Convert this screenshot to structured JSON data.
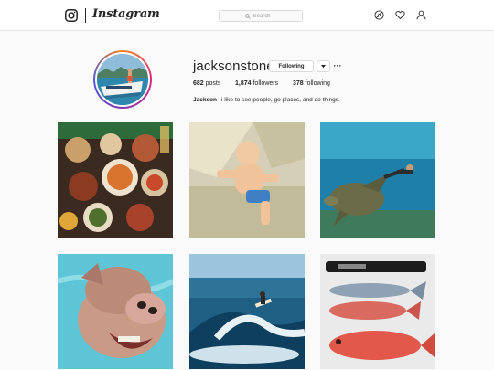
{
  "header": {
    "logo_text": "Instagram",
    "search": {
      "placeholder": "Search"
    },
    "icons": [
      "explore-compass-icon",
      "heart-activity-icon",
      "profile-person-icon"
    ]
  },
  "profile": {
    "username": "jacksonstone",
    "following_button_label": "Following",
    "more_label": "···",
    "stats": {
      "posts_count": "682",
      "posts_label": "posts",
      "followers_count": "1,874",
      "followers_label": "followers",
      "following_count": "378",
      "following_label": "following"
    },
    "bio": {
      "name": "Jackson",
      "text": "i like to see people, go places, and do things."
    }
  },
  "grid": {
    "posts": [
      {
        "subject": "food-spread-table"
      },
      {
        "subject": "toddler-on-mat"
      },
      {
        "subject": "snorkeler-with-sea-turtle"
      },
      {
        "subject": "swimming-pig"
      },
      {
        "subject": "surfer-on-wave"
      },
      {
        "subject": "fish-on-counter"
      }
    ]
  },
  "colors": {
    "accent_text": "#262626",
    "border": "#dbdbdb",
    "background": "#fafafa"
  }
}
